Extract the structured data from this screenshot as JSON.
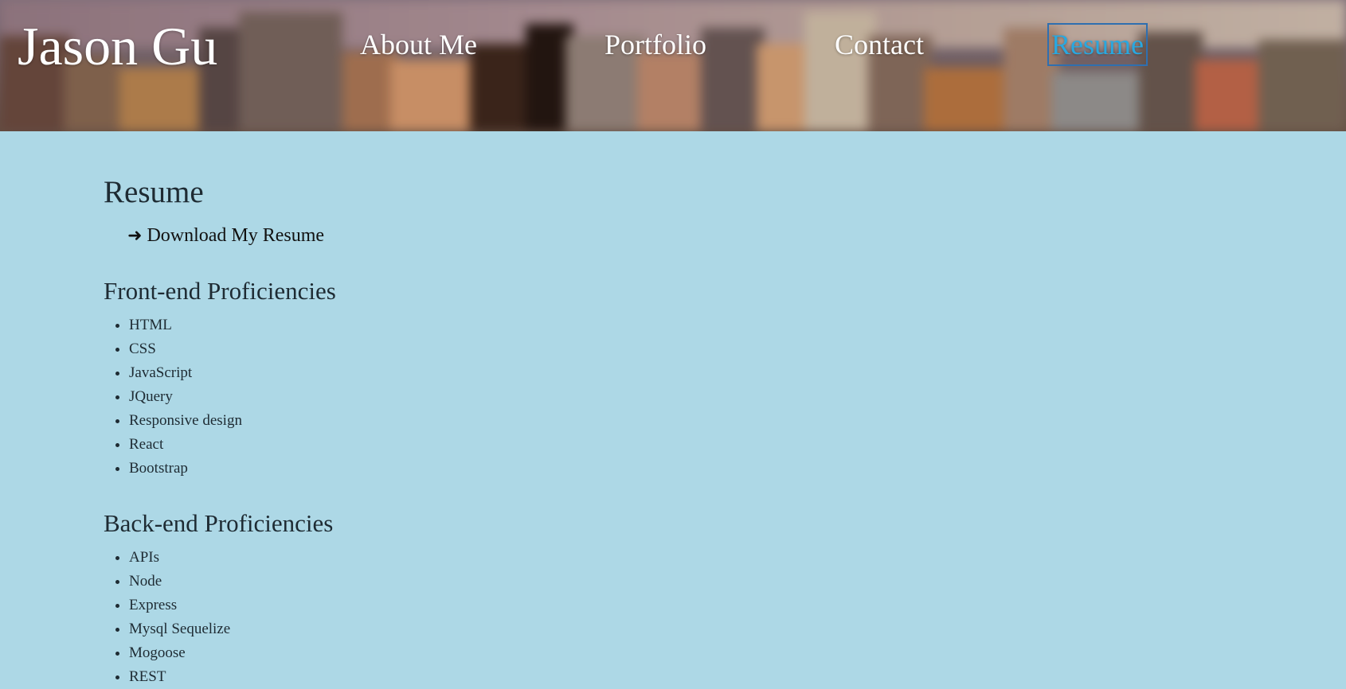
{
  "header": {
    "brand": "Jason Gu",
    "nav": [
      {
        "label": "About Me",
        "active": false
      },
      {
        "label": "Portfolio",
        "active": false
      },
      {
        "label": "Contact",
        "active": false
      },
      {
        "label": "Resume",
        "active": true
      }
    ],
    "active_color": "#29a8e0"
  },
  "main": {
    "title": "Resume",
    "download_label": "Download My Resume",
    "sections": [
      {
        "title": "Front-end Proficiencies",
        "items": [
          "HTML",
          "CSS",
          "JavaScript",
          "JQuery",
          "Responsive design",
          "React",
          "Bootstrap"
        ]
      },
      {
        "title": "Back-end Proficiencies",
        "items": [
          "APIs",
          "Node",
          "Express",
          "Mysql Sequelize",
          "Mogoose",
          "REST"
        ]
      }
    ]
  },
  "colors": {
    "page_background": "#add8e6",
    "text": "#1e2b33"
  }
}
